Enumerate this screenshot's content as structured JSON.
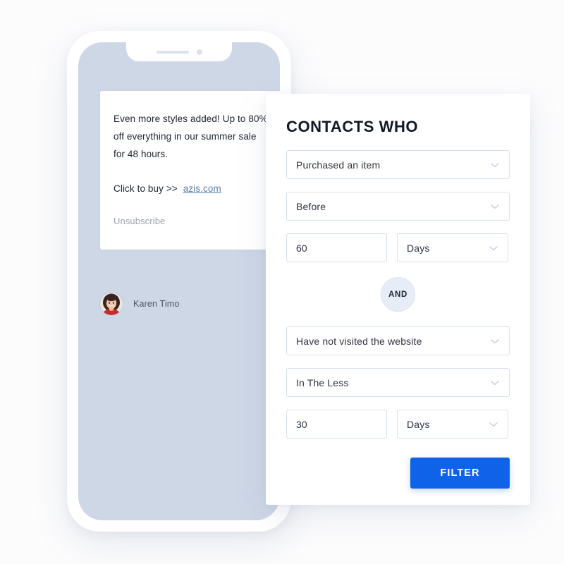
{
  "phone": {
    "message": {
      "lines": [
        "Even more styles added! Up to 80%",
        "off everything in our summer sale",
        "for 48 hours."
      ],
      "cta_text": "Click to buy  >>",
      "cta_link": "azis.com",
      "unsubscribe": "Unsubscribe"
    },
    "sender": {
      "name": "Karen Timo",
      "avatar_alt": "avatar-photo"
    }
  },
  "panel": {
    "title": "CONTACTS WHO",
    "condition_one": {
      "event": {
        "value": "Purchased an item",
        "icon": "chevron-down-icon"
      },
      "operator": {
        "value": "Before",
        "icon": "chevron-down-icon"
      },
      "amount": {
        "value": "60",
        "placeholder": "0"
      },
      "unit": {
        "value": "Days",
        "icon": "chevron-down-icon"
      }
    },
    "connector": {
      "label": "AND"
    },
    "condition_two": {
      "event": {
        "value": "Have not visited the website",
        "icon": "chevron-down-icon"
      },
      "operator": {
        "value": "In The Less",
        "icon": "chevron-down-icon"
      },
      "amount": {
        "value": "30",
        "placeholder": "0"
      },
      "unit": {
        "value": "Days",
        "icon": "chevron-down-icon"
      }
    },
    "submit": {
      "label": "FILTER"
    }
  },
  "colors": {
    "accent": "#0E63E9",
    "panel_bg": "#FFFFFF",
    "page_bg": "#FCFCFD",
    "phone_screen": "#CDD7E6",
    "field_border": "#D7E0EB",
    "link": "#5B80A8",
    "and_badge_bg": "#E7EDF6",
    "title": "#111827"
  }
}
